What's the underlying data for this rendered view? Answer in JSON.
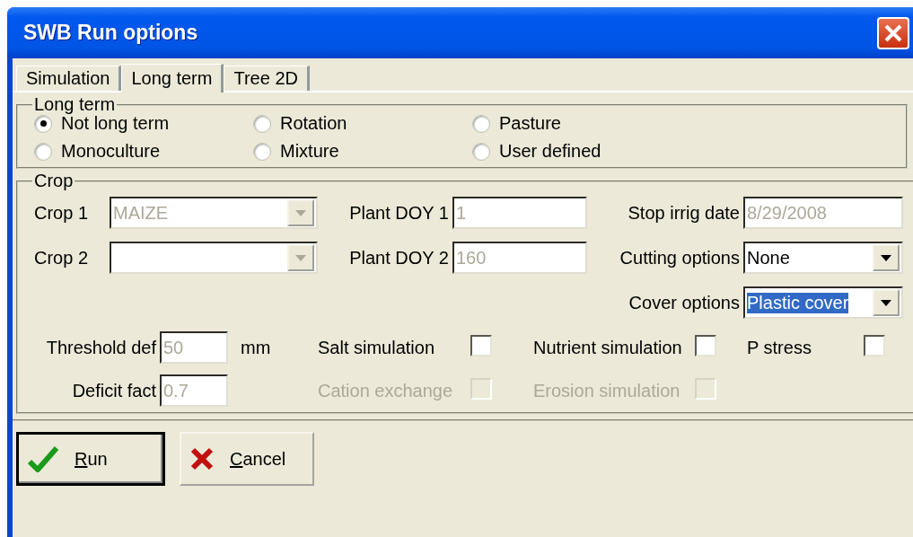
{
  "window": {
    "title": "SWB Run options"
  },
  "tabs": [
    {
      "label": "Simulation",
      "selected": false
    },
    {
      "label": "Long term",
      "selected": true
    },
    {
      "label": "Tree 2D",
      "selected": false
    }
  ],
  "long_term": {
    "title": "Long term",
    "options": [
      {
        "label": "Not long term",
        "selected": true
      },
      {
        "label": "Rotation",
        "selected": false
      },
      {
        "label": "Pasture",
        "selected": false
      },
      {
        "label": "Monoculture",
        "selected": false
      },
      {
        "label": "Mixture",
        "selected": false
      },
      {
        "label": "User defined",
        "selected": false
      }
    ]
  },
  "crop": {
    "title": "Crop",
    "fields": [
      {
        "kind": "combo",
        "label": "Crop 1",
        "value": "MAIZE",
        "disabled": true
      },
      {
        "kind": "text",
        "label": "Plant DOY 1",
        "value": "1",
        "disabled": true
      },
      {
        "kind": "text",
        "label": "Stop irrig date",
        "value": "8/29/2008",
        "disabled": true
      },
      {
        "kind": "combo",
        "label": "Crop 2",
        "disabled": true
      },
      {
        "kind": "text",
        "label": "Plant DOY 2",
        "value": "160",
        "disabled": true
      },
      {
        "kind": "combo",
        "label": "Cutting options",
        "value": "None",
        "disabled": false
      },
      {
        "kind": "empty"
      },
      {
        "kind": "empty"
      },
      {
        "kind": "combo",
        "label": "Cover options",
        "value": "Plastic cover",
        "disabled": false,
        "text_selected": true
      }
    ],
    "threshold_def": {
      "label": "Threshold def",
      "value": "50",
      "unit": "mm",
      "disabled": true
    },
    "deficit_fact": {
      "label": "Deficit fact",
      "value": "0.7",
      "disabled": true
    },
    "checks": [
      {
        "label": "Salt simulation",
        "checked": false,
        "disabled": false
      },
      {
        "label": "Nutrient simulation",
        "checked": false,
        "disabled": false
      },
      {
        "label": "P stress",
        "checked": false,
        "disabled": false
      },
      {
        "label": "Cation exchange",
        "checked": false,
        "disabled": true
      },
      {
        "label": "Erosion simulation",
        "checked": false,
        "disabled": true
      }
    ]
  },
  "buttons": [
    {
      "kind": "run",
      "label": "Run",
      "underline_first": true,
      "default": true
    },
    {
      "kind": "cancel",
      "label": "Cancel",
      "underline_first": true,
      "default": false
    }
  ]
}
